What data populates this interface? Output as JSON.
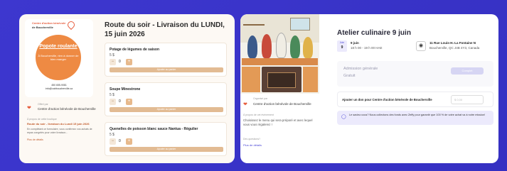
{
  "left_card": {
    "logo": {
      "brand_line1": "Centre d'action bénévole",
      "brand_line2": "de Boucherville",
      "badge_title": "Popote roulante",
      "badge_text": "À Boucherville, rien à donner de bien manger",
      "phone": "450 655-9081",
      "email": "info@cabboucherville.ca"
    },
    "organizer": {
      "caption": "Offert par",
      "name": "Centre d'action bénévole de Boucherville"
    },
    "about": {
      "caption": "À propos de cette boutique",
      "title": "Route du soir - livraison du Lundi 15 juin 2026",
      "description": "En complétant ce formulaire, vous confirmez vos achats de repas congelés pour votre livraison...",
      "more_link": "Plus de détails"
    },
    "title": "Route du soir - Livraison du LUNDI, 15 juin 2026",
    "items": [
      {
        "name": "Potage de légumes de saison",
        "price": "5 $",
        "qty": "0",
        "add_label": "Ajouter au panier"
      },
      {
        "name": "Soupe Minestrone",
        "price": "5 $",
        "qty": "0",
        "add_label": "Ajouter au panier"
      },
      {
        "name": "Quenelles de poisson blanc sauce Nantua - Régulier",
        "price": "5 $",
        "qty": "0",
        "add_label": "Ajouter au panier"
      }
    ]
  },
  "right_card": {
    "organizer": {
      "caption": "Organisé par",
      "name": "Centre d'action bénévole de Boucherville"
    },
    "about": {
      "caption": "À propos de cet événement",
      "description": "Choisissez le menu qui sera préparé et avec lequel vous vous régalerez !",
      "question": "Des questions?",
      "more_link": "Plus de détails"
    },
    "title": "Atelier culinaire 9 juin",
    "date": {
      "month": "Juin",
      "day": "9",
      "line1": "9 juin",
      "line2": "18 h 00 - 19 h 00 HAE"
    },
    "location": {
      "line1": "11 Rue Louis-H.-La Fontaine N",
      "line2": "Boucherville, QC J4B 4Y3, Canada"
    },
    "ticket": {
      "name": "Admission générale",
      "price": "Gratuit",
      "button": "Complet"
    },
    "donation": {
      "label": "Ajouter un don pour Centre d'action bénévole de Boucherville",
      "placeholder": "$ 0,00"
    },
    "tip": "Le saviez-vous? Nous collectons des fonds avec Zeffy pour garantir que 100 % de votre achat va à notre mission!"
  },
  "colors": {
    "background": "#3a34c9",
    "accent_orange": "#e2bb93",
    "accent_purple": "#4b47d6"
  }
}
